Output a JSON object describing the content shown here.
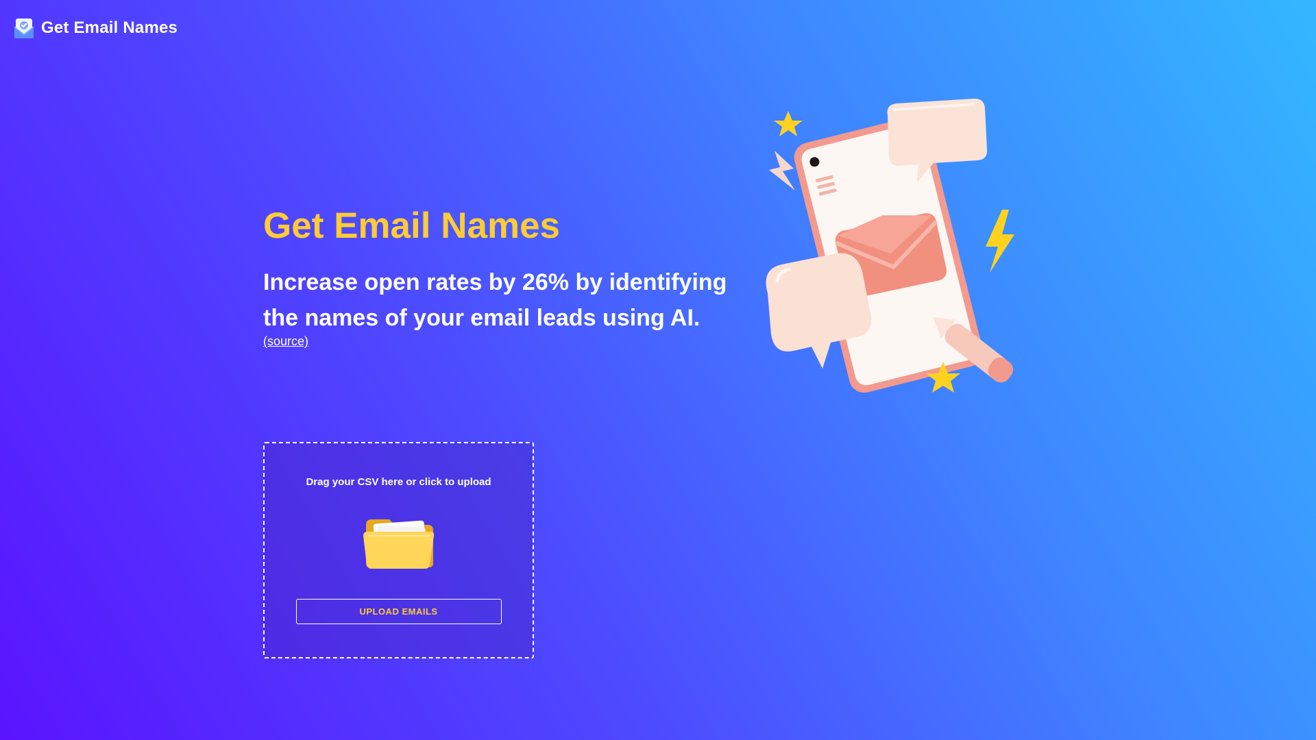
{
  "header": {
    "brand_name": "Get Email Names",
    "logo_icon": "email-check-icon"
  },
  "hero": {
    "title": "Get Email Names",
    "subtitle": "Increase open rates by 26% by identifying the names of your email leads using AI.",
    "source_link": "(source)",
    "illustration_icon": "phone-envelope-chat-illustration"
  },
  "upload": {
    "drop_text": "Drag your CSV here or click to upload",
    "folder_icon": "folder-icon",
    "button_label": "UPLOAD EMAILS"
  },
  "colors": {
    "accent": "#ffcc33",
    "gradient_start": "#5a14ff",
    "gradient_end": "#33b7ff"
  }
}
